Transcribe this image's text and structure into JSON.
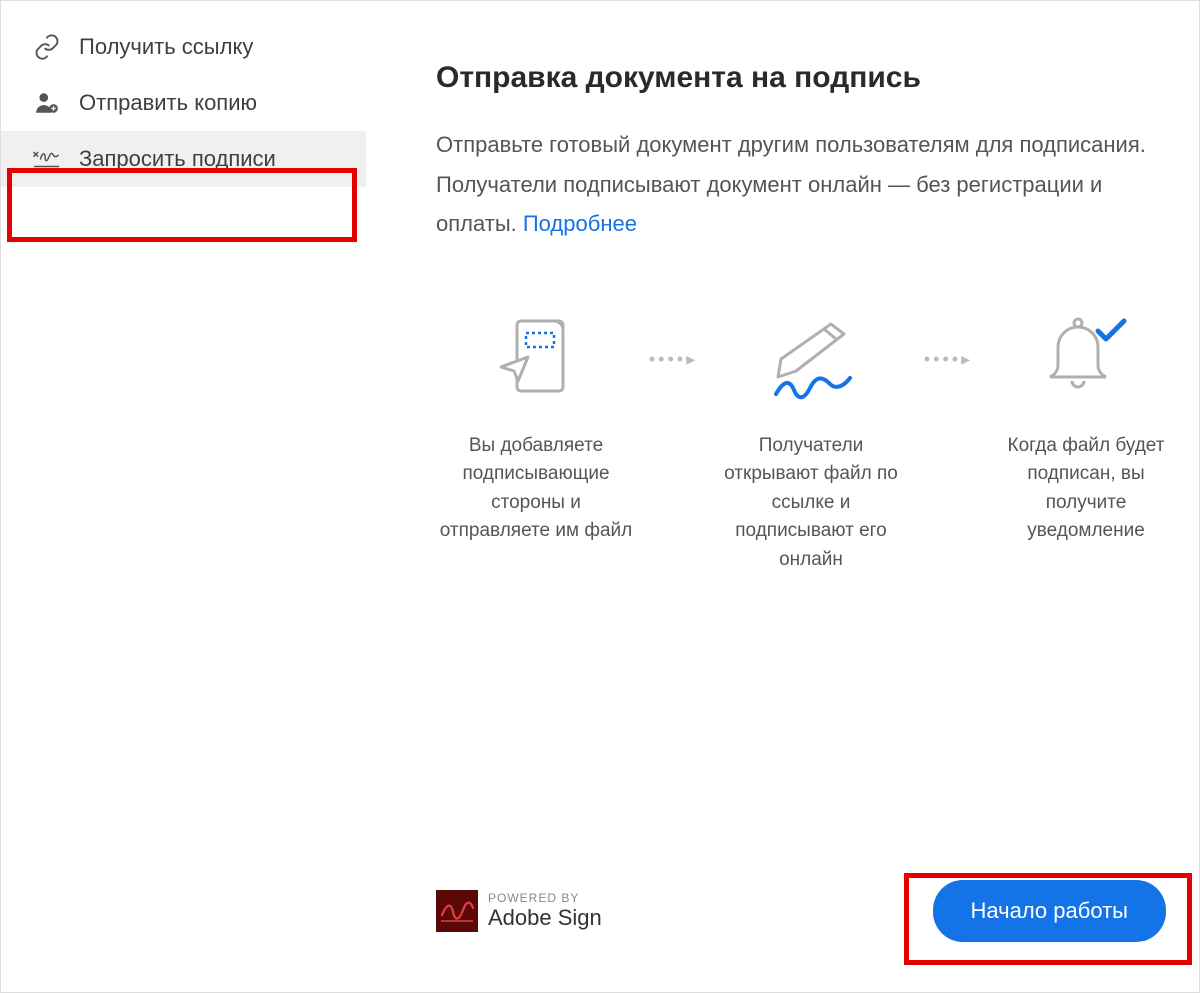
{
  "sidebar": {
    "items": [
      {
        "label": "Получить ссылку"
      },
      {
        "label": "Отправить копию"
      },
      {
        "label": "Запросить подписи"
      }
    ]
  },
  "main": {
    "title": "Отправка документа на подпись",
    "description_part1": "Отправьте готовый документ другим пользователям для подписания. Получатели подписывают документ онлайн — без регистрации и оплаты. ",
    "learn_more": "Подробнее",
    "steps": [
      {
        "text": "Вы добавляете подписывающие стороны и отправляете им файл"
      },
      {
        "text": "Получатели открывают файл по ссылке и подписывают его онлайн"
      },
      {
        "text": "Когда файл будет подписан, вы получите уведомление"
      }
    ],
    "powered_label": "POWERED BY",
    "powered_brand": "Adobe Sign",
    "start_button": "Начало работы"
  }
}
